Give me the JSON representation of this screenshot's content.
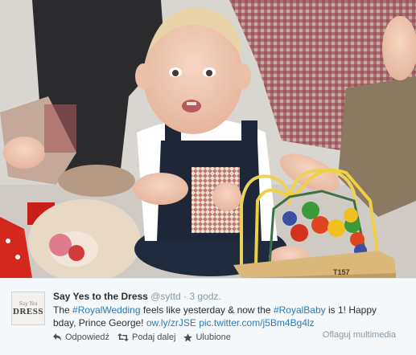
{
  "tweet": {
    "avatar_small": "Say Yes",
    "avatar_big": "DRESS",
    "fullname": "Say Yes to the Dress",
    "username": "@syttd",
    "separator": "·",
    "time": "3 godz.",
    "text": {
      "t1": "The ",
      "h1": "#RoyalWedding",
      "t2": " feels like yesterday & now the ",
      "h2": "#RoyalBaby",
      "t3": " is 1! Happy bday, Prince George! ",
      "l1": "ow.ly/zrJSE",
      "t4": " ",
      "l2": "pic.twitter.com/j5Bm4Bg4lz"
    },
    "actions": {
      "reply": "Odpowiedź",
      "retweet": "Podaj dalej",
      "favorite": "Ulubione"
    },
    "flag_media": "Oflaguj multimedia"
  },
  "media": {
    "toy_label": "T157"
  },
  "colors": {
    "link": "#2b7bb9",
    "tweet_bg": "#f5f8fa",
    "meta_grey": "#8899a6"
  }
}
